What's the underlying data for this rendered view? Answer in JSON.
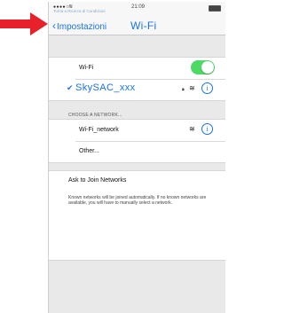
{
  "statusbar": {
    "signal": "●●●●○",
    "time": "21:09",
    "back_app": "Torna a Ricerca di Condizioni"
  },
  "navbar": {
    "back_label": "Impostazioni",
    "title": "Wi-Fi"
  },
  "wifi_toggle": {
    "label": "Wi-Fi",
    "state": "on",
    "color": "#4cd964"
  },
  "connected": {
    "ssid": "SkySAC_xxx"
  },
  "networks": {
    "header": "CHOOSE A NETWORK...",
    "items": [
      {
        "label": "Wi-Fi_network"
      },
      {
        "label": "Other..."
      }
    ]
  },
  "ask": {
    "label": "Ask to Join Networks",
    "description": "Known networks will be joined automatically. If no known networks are available, you will have to manually select a network."
  },
  "colors": {
    "accent": "#1a73e8",
    "arrow": "#e8202a"
  }
}
